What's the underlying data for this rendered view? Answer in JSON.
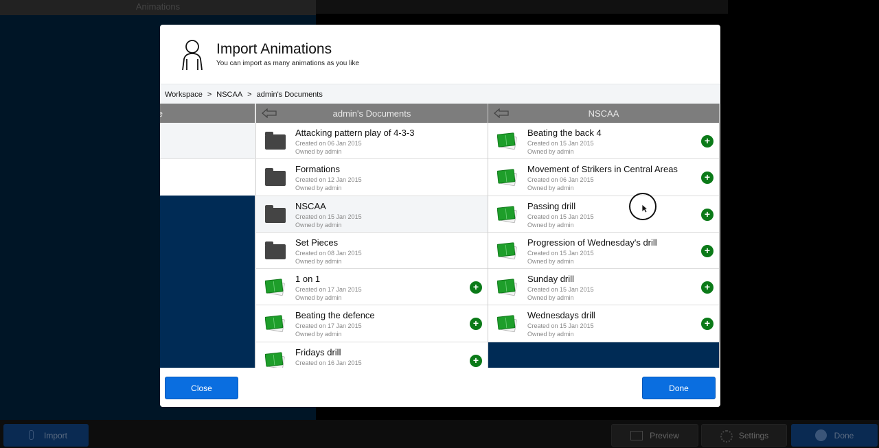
{
  "background": {
    "left_panel_title": "Animations",
    "bottom_bar": {
      "import_label": "Import",
      "preview_label": "Preview",
      "settings_label": "Settings",
      "done_label": "Done"
    }
  },
  "modal": {
    "title": "Import Animations",
    "subtitle": "You can import as many animations as you like",
    "breadcrumb": [
      "Workspace",
      "NSCAA",
      "admin's Documents"
    ],
    "breadcrumb_separator": ">",
    "columns": {
      "col0_title": "e",
      "col1_title": "admin's Documents",
      "col2_title": "NSCAA"
    },
    "col1_items": [
      {
        "type": "folder",
        "title": "Attacking pattern play of 4-3-3",
        "date": "Created on 06 Jan 2015",
        "owner": "Owned by admin",
        "selected": false
      },
      {
        "type": "folder",
        "title": "Formations",
        "date": "Created on 12 Jan 2015",
        "owner": "Owned by admin",
        "selected": false
      },
      {
        "type": "folder",
        "title": "NSCAA",
        "date": "Created on 15 Jan 2015",
        "owner": "Owned by admin",
        "selected": true
      },
      {
        "type": "folder",
        "title": "Set Pieces",
        "date": "Created on 08 Jan 2015",
        "owner": "Owned by admin",
        "selected": false
      },
      {
        "type": "animation",
        "title": "1 on 1",
        "date": "Created on 17 Jan 2015",
        "owner": "Owned by admin",
        "selected": false
      },
      {
        "type": "animation",
        "title": "Beating the defence",
        "date": "Created on 17 Jan 2015",
        "owner": "Owned by admin",
        "selected": false
      },
      {
        "type": "animation",
        "title": "Fridays drill",
        "date": "Created on 16 Jan 2015",
        "owner": "",
        "selected": false
      }
    ],
    "col2_items": [
      {
        "type": "animation",
        "title": "Beating the back 4",
        "date": "Created on 15 Jan 2015",
        "owner": "Owned by admin"
      },
      {
        "type": "animation",
        "title": "Movement of Strikers in Central Areas",
        "date": "Created on 06 Jan 2015",
        "owner": "Owned by admin"
      },
      {
        "type": "animation",
        "title": "Passing drill",
        "date": "Created on 15 Jan 2015",
        "owner": "Owned by admin"
      },
      {
        "type": "animation",
        "title": "Progression of Wednesday's drill",
        "date": "Created on 15 Jan 2015",
        "owner": "Owned by admin"
      },
      {
        "type": "animation",
        "title": "Sunday drill",
        "date": "Created on 15 Jan 2015",
        "owner": "Owned by admin"
      },
      {
        "type": "animation",
        "title": "Wednesdays drill",
        "date": "Created on 15 Jan 2015",
        "owner": "Owned by admin"
      }
    ],
    "add_symbol": "+",
    "close_label": "Close",
    "done_label": "Done"
  },
  "colors": {
    "accent_blue": "#0a6ee0",
    "add_green": "#0b7a18",
    "column_header": "#7d7d7d",
    "navy": "#002b55"
  }
}
